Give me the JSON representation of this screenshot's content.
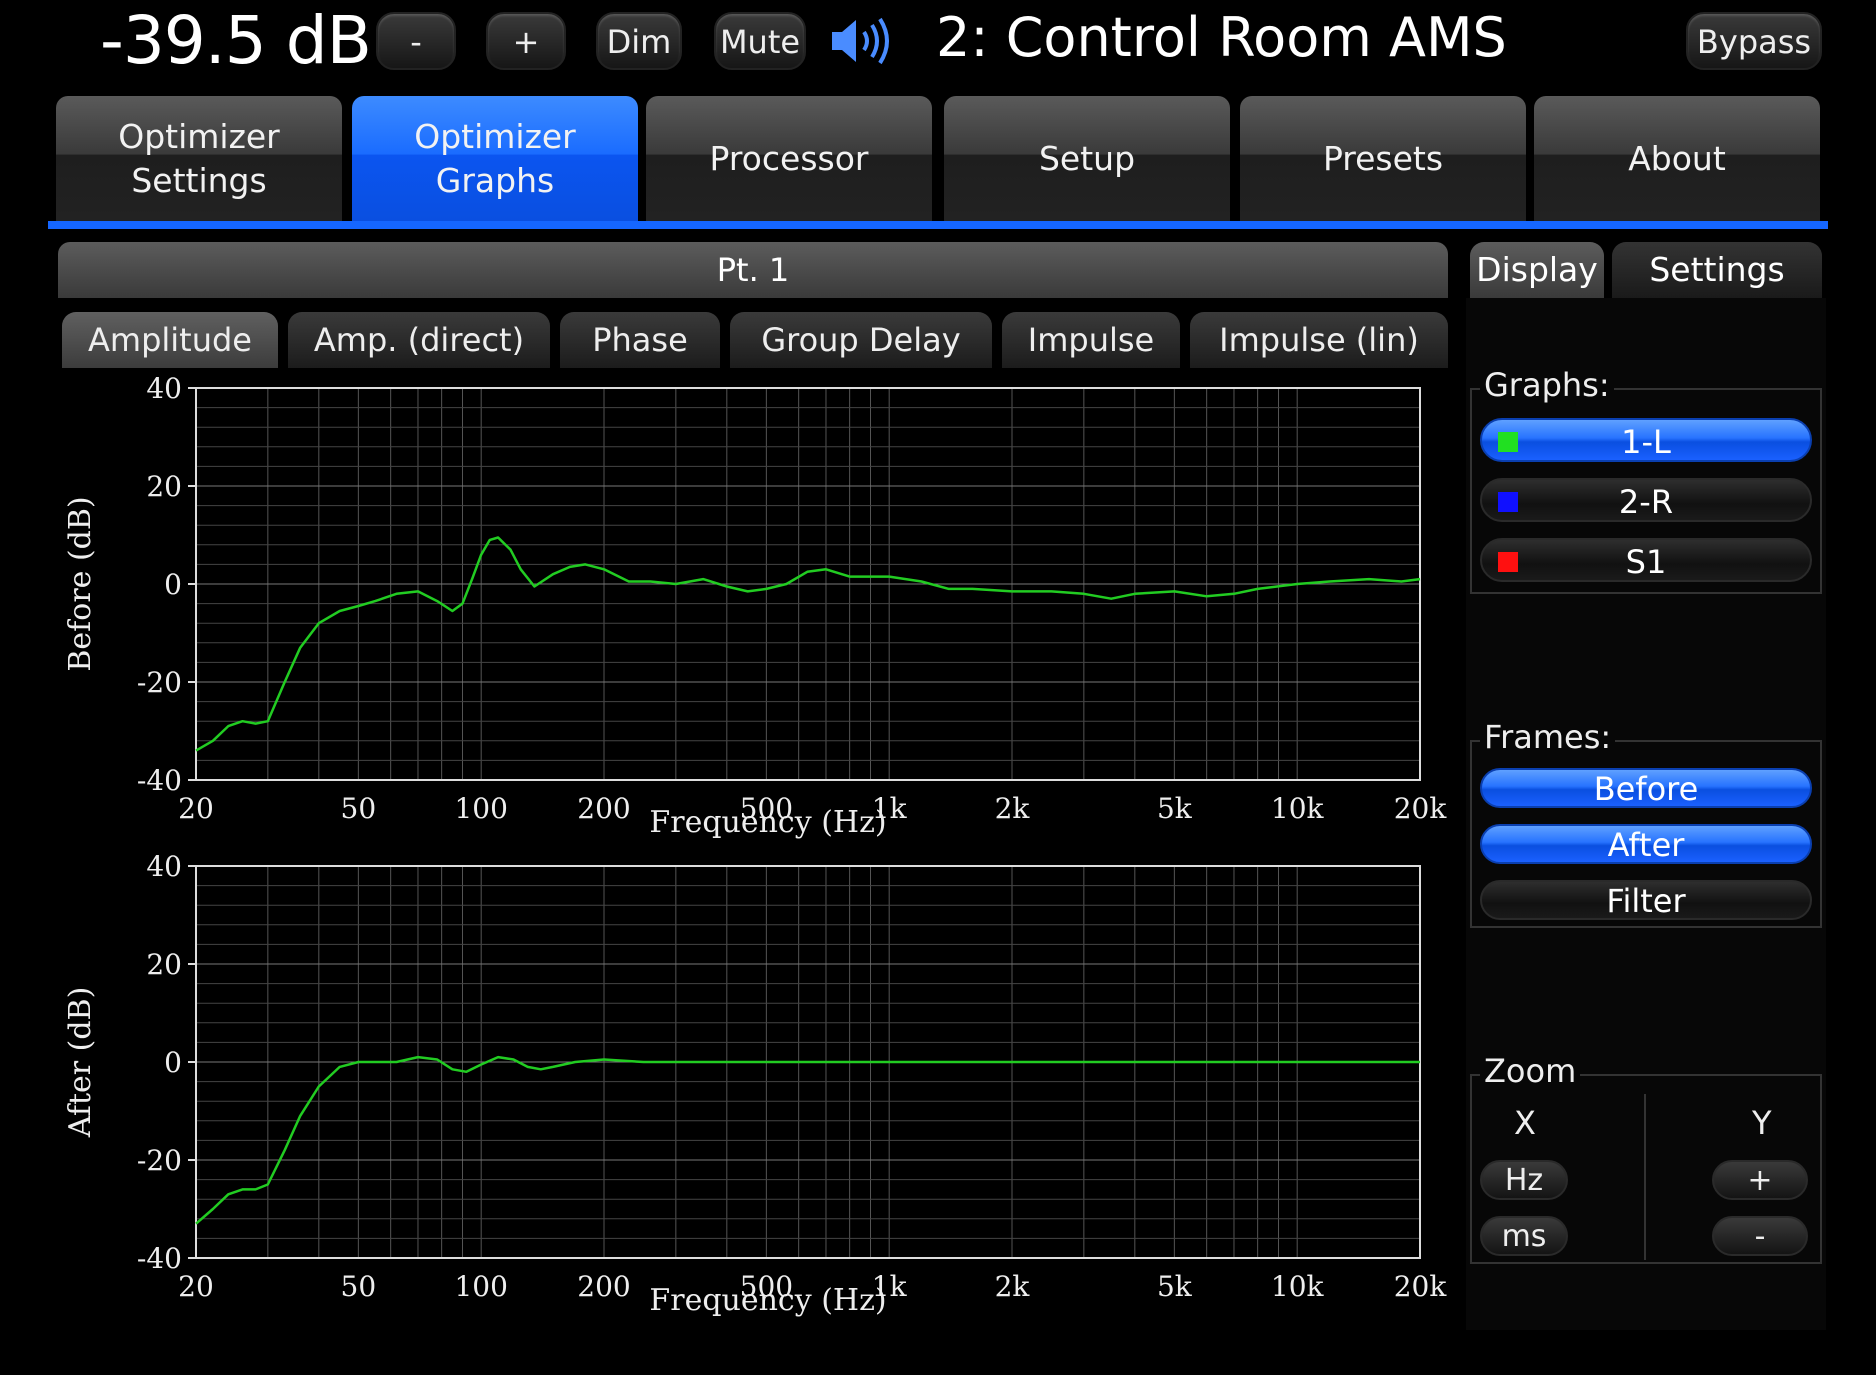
{
  "top": {
    "volume": "-39.5 dB",
    "minus": "-",
    "plus": "+",
    "dim": "Dim",
    "mute": "Mute",
    "room": "2: Control Room AMS",
    "bypass": "Bypass"
  },
  "tabs": [
    {
      "line1": "Optimizer",
      "line2": "Settings",
      "active": false
    },
    {
      "line1": "Optimizer",
      "line2": "Graphs",
      "active": true
    },
    {
      "line1": "Processor",
      "line2": "",
      "active": false
    },
    {
      "line1": "Setup",
      "line2": "",
      "active": false
    },
    {
      "line1": "Presets",
      "line2": "",
      "active": false
    },
    {
      "line1": "About",
      "line2": "",
      "active": false
    }
  ],
  "point": "Pt. 1",
  "subtabs": [
    "Amplitude",
    "Amp. (direct)",
    "Phase",
    "Group Delay",
    "Impulse",
    "Impulse (lin)"
  ],
  "right": {
    "tab_display": "Display",
    "tab_settings": "Settings",
    "graphs_label": "Graphs:",
    "graphs": [
      {
        "label": "1-L",
        "color": "#21e021",
        "on": true
      },
      {
        "label": "2-R",
        "color": "#1010ff",
        "on": false
      },
      {
        "label": "S1",
        "color": "#ff1010",
        "on": false
      }
    ],
    "frames_label": "Frames:",
    "frames": [
      {
        "label": "Before",
        "on": true
      },
      {
        "label": "After",
        "on": true
      },
      {
        "label": "Filter",
        "on": false
      }
    ],
    "zoom_label": "Zoom",
    "zoom_x": "X",
    "zoom_y": "Y",
    "zoom_hz": "Hz",
    "zoom_ms": "ms",
    "zoom_plus": "+",
    "zoom_minus": "-"
  },
  "chart_data": [
    {
      "type": "line",
      "ylabel": "Before (dB)",
      "xlabel": "Frequency (Hz)",
      "xscale": "log",
      "xlim": [
        20,
        20000
      ],
      "ylim": [
        -40,
        40
      ],
      "xticks": [
        "20",
        "50",
        "100",
        "200",
        "500",
        "1k",
        "2k",
        "5k",
        "10k",
        "20k"
      ],
      "xtick_values": [
        20,
        50,
        100,
        200,
        500,
        1000,
        2000,
        5000,
        10000,
        20000
      ],
      "yticks": [
        "40",
        "20",
        "0",
        "-20",
        "-40"
      ],
      "ytick_values": [
        40,
        20,
        0,
        -20,
        -40
      ],
      "series": [
        {
          "color": "#22cc22",
          "x": [
            20,
            22,
            24,
            26,
            28,
            30,
            33,
            36,
            40,
            45,
            50,
            55,
            62,
            70,
            78,
            85,
            90,
            95,
            100,
            105,
            110,
            118,
            125,
            135,
            150,
            165,
            180,
            200,
            230,
            260,
            300,
            350,
            400,
            450,
            500,
            560,
            630,
            700,
            800,
            900,
            1000,
            1200,
            1400,
            1600,
            2000,
            2500,
            3000,
            3500,
            4000,
            5000,
            6000,
            7000,
            8000,
            10000,
            12000,
            15000,
            18000,
            20000
          ],
          "y": [
            -34,
            -32,
            -29,
            -28,
            -28.5,
            -28,
            -20,
            -13,
            -8,
            -5.5,
            -4.5,
            -3.5,
            -2,
            -1.5,
            -3.5,
            -5.5,
            -4,
            1,
            6,
            9,
            9.5,
            7,
            3,
            -0.5,
            2,
            3.5,
            4,
            3,
            0.5,
            0.5,
            0,
            1,
            -0.5,
            -1.5,
            -1,
            0,
            2.5,
            3,
            1.5,
            1.5,
            1.5,
            0.5,
            -1,
            -1,
            -1.5,
            -1.5,
            -2,
            -3,
            -2,
            -1.5,
            -2.5,
            -2,
            -1,
            0,
            0.5,
            1,
            0.5,
            1
          ]
        }
      ]
    },
    {
      "type": "line",
      "ylabel": "After (dB)",
      "xlabel": "Frequency (Hz)",
      "xscale": "log",
      "xlim": [
        20,
        20000
      ],
      "ylim": [
        -40,
        40
      ],
      "xticks": [
        "20",
        "50",
        "100",
        "200",
        "500",
        "1k",
        "2k",
        "5k",
        "10k",
        "20k"
      ],
      "xtick_values": [
        20,
        50,
        100,
        200,
        500,
        1000,
        2000,
        5000,
        10000,
        20000
      ],
      "yticks": [
        "40",
        "20",
        "0",
        "-20",
        "-40"
      ],
      "ytick_values": [
        40,
        20,
        0,
        -20,
        -40
      ],
      "series": [
        {
          "color": "#22cc22",
          "x": [
            20,
            22,
            24,
            26,
            28,
            30,
            33,
            36,
            40,
            45,
            50,
            55,
            62,
            70,
            78,
            85,
            92,
            100,
            110,
            120,
            130,
            140,
            150,
            170,
            200,
            250,
            300,
            400,
            500,
            700,
            1000,
            2000,
            5000,
            10000,
            20000
          ],
          "y": [
            -33,
            -30,
            -27,
            -26,
            -26,
            -25,
            -18,
            -11,
            -5,
            -1,
            0,
            0,
            0,
            1,
            0.5,
            -1.5,
            -2,
            -0.5,
            1,
            0.5,
            -1,
            -1.5,
            -1,
            0,
            0.5,
            0,
            0,
            0,
            0,
            0,
            0,
            0,
            0,
            0,
            0
          ]
        }
      ]
    }
  ]
}
